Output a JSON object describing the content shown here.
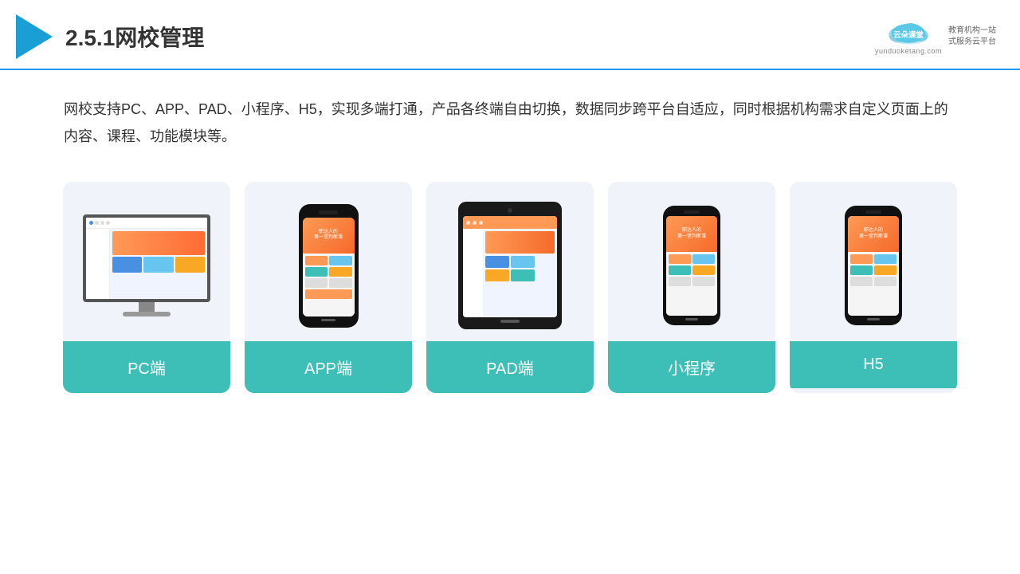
{
  "header": {
    "title": "2.5.1网校管理",
    "logo": {
      "name_cn": "云朵课堂",
      "name_en": "yunduoketang.com",
      "slogan_line1": "教育机构一站",
      "slogan_line2": "式服务云平台"
    }
  },
  "description": {
    "text": "网校支持PC、APP、PAD、小程序、H5，实现多端打通，产品各终端自由切换，数据同步跨平台自适应，同时根据机构需求自定义页面上的内容、课程、功能模块等。"
  },
  "cards": [
    {
      "id": "pc",
      "label": "PC端",
      "device": "pc"
    },
    {
      "id": "app",
      "label": "APP端",
      "device": "phone"
    },
    {
      "id": "pad",
      "label": "PAD端",
      "device": "tablet"
    },
    {
      "id": "miniprogram",
      "label": "小程序",
      "device": "phone-sm"
    },
    {
      "id": "h5",
      "label": "H5",
      "device": "phone-sm2"
    }
  ]
}
